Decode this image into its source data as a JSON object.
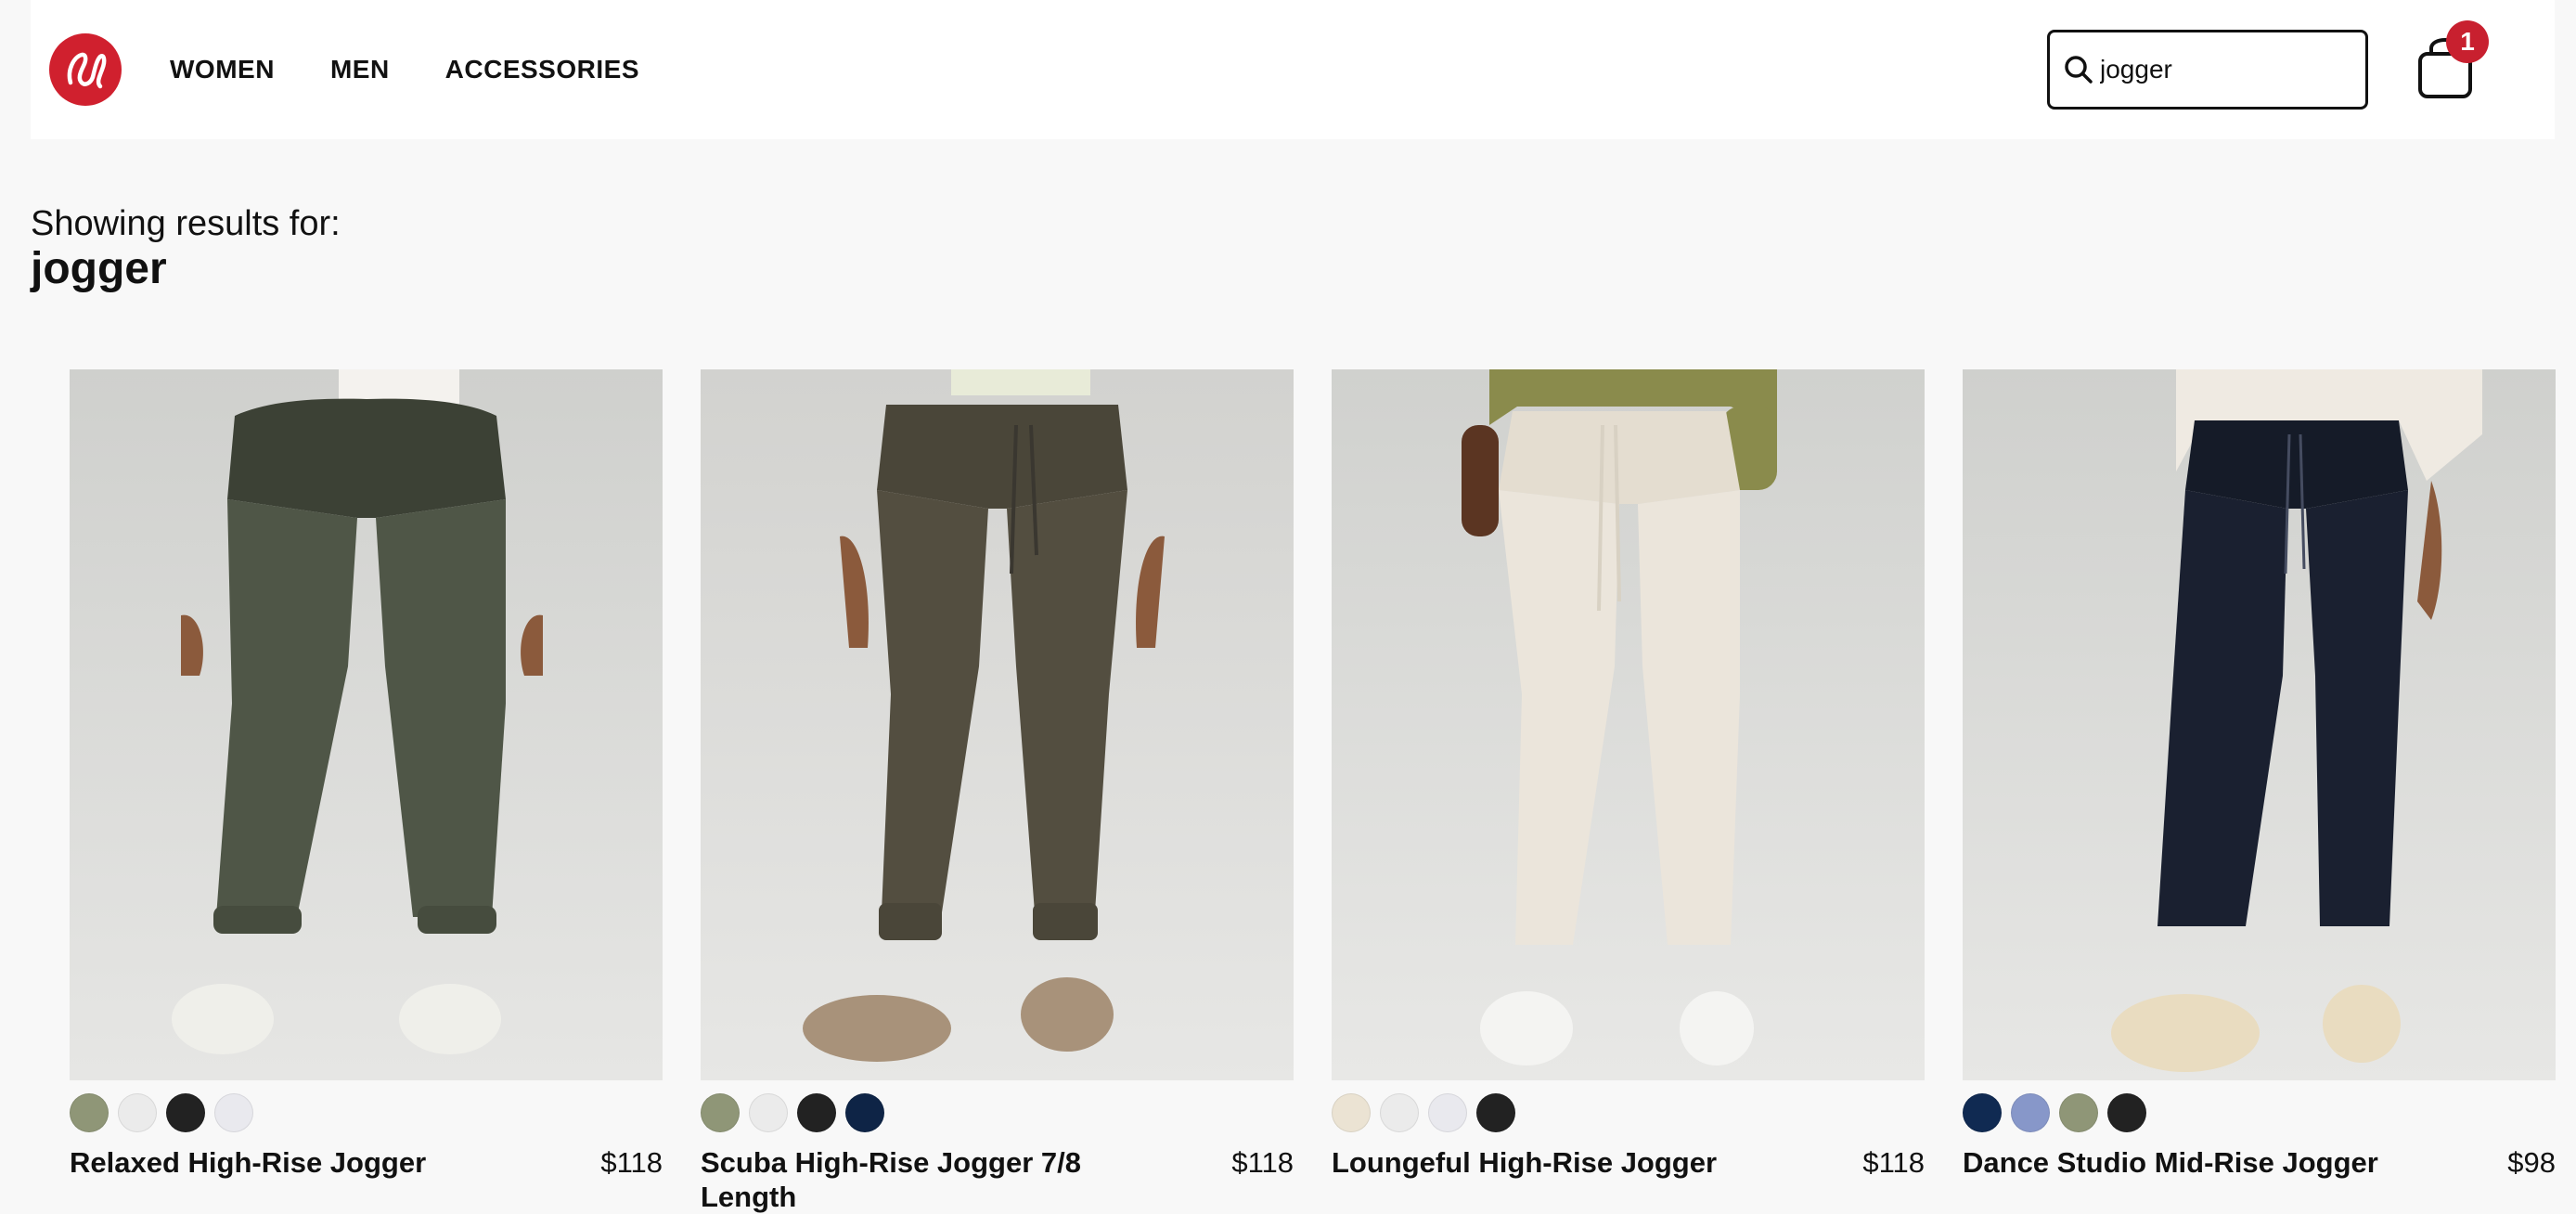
{
  "header": {
    "logo": {
      "icon": "lululemon-logo-icon",
      "color": "#d0202e"
    },
    "nav": [
      {
        "label": "WOMEN"
      },
      {
        "label": "MEN"
      },
      {
        "label": "ACCESSORIES"
      }
    ],
    "search": {
      "value": "jogger",
      "icon": "search-icon"
    },
    "cart": {
      "icon": "shopping-bag-icon",
      "count": "1",
      "badge_color": "#c8202f"
    }
  },
  "results": {
    "label": "Showing results for:",
    "query": "jogger"
  },
  "products": [
    {
      "name": "Relaxed High-Rise Jogger",
      "price": "$118",
      "image_desc": "olive green relaxed jogger pants",
      "pant_color": "#4f5647",
      "swatches": [
        "#8f9677",
        "#ebebeb",
        "#222222",
        "#e9e9ee"
      ]
    },
    {
      "name": "Scuba High-Rise Jogger 7/8 Length",
      "price": "$118",
      "image_desc": "brown-olive scuba jogger pants",
      "pant_color": "#534e40",
      "swatches": [
        "#8f9677",
        "#ebebeb",
        "#222222",
        "#0e2446"
      ]
    },
    {
      "name": "Loungeful High-Rise Jogger",
      "price": "$118",
      "image_desc": "ivory loungeful jogger pants",
      "pant_color": "#ebe5db",
      "swatches": [
        "#ebe3d3",
        "#ebebeb",
        "#e9e9ee",
        "#222222"
      ]
    },
    {
      "name": "Dance Studio Mid-Rise Jogger",
      "price": "$98",
      "image_desc": "navy dance studio jogger pants",
      "pant_color": "#1a2030",
      "swatches": [
        "#102a52",
        "#8797c9",
        "#8f9677",
        "#222222"
      ]
    }
  ]
}
